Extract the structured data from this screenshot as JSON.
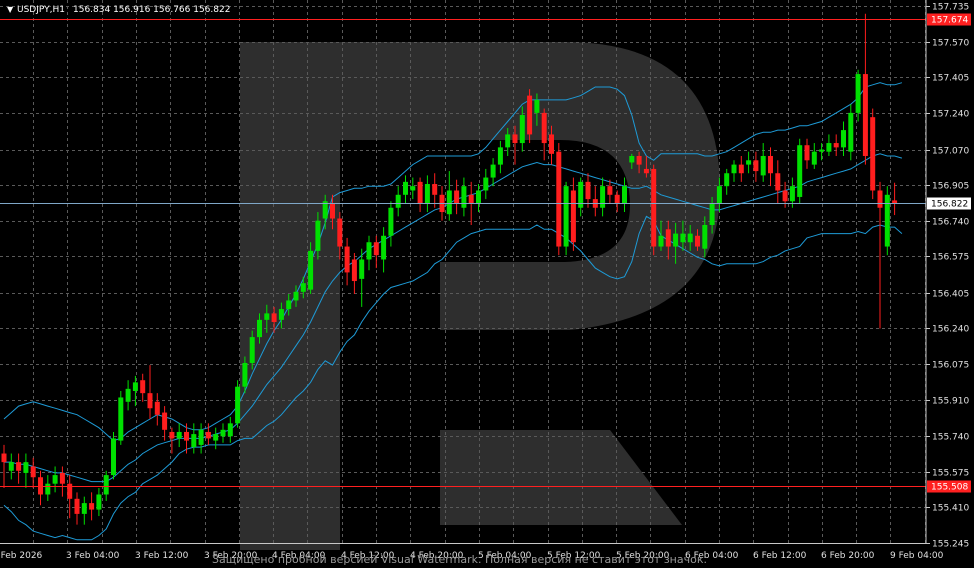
{
  "header": {
    "symbol": "USDJPY,H1",
    "ohlc": "156.834 156.916 156.766 156.822"
  },
  "watermark_text": "Защищено пробной версией Visual Watermark. Полная версия не ставит этот значок.",
  "colors": {
    "background": "#000000",
    "grid": "#5a5a5a",
    "bull": "#00e000",
    "bear": "#ff1e1e",
    "bands": "#1e9bd7",
    "level_line": "#ff2020",
    "price_line": "#7fa7c8",
    "watermark": "#3c3c3c"
  },
  "chart_data": {
    "type": "candlestick",
    "symbol": "USDJPY",
    "timeframe": "H1",
    "y_range": [
      155.245,
      157.7635
    ],
    "y_ticks": [
      "157.735",
      "157.570",
      "157.405",
      "157.240",
      "157.070",
      "156.905",
      "156.740",
      "156.575",
      "156.405",
      "156.240",
      "156.075",
      "155.910",
      "155.740",
      "155.575",
      "155.410",
      "155.245"
    ],
    "x_ticks": [
      "2 Feb 2026",
      "3 Feb 04:00",
      "3 Feb 12:00",
      "3 Feb 20:00",
      "4 Feb 04:00",
      "4 Feb 12:00",
      "4 Feb 20:00",
      "5 Feb 04:00",
      "5 Feb 12:00",
      "5 Feb 20:00",
      "6 Feb 04:00",
      "6 Feb 12:00",
      "6 Feb 20:00",
      "9 Feb 04:00"
    ],
    "levels": [
      {
        "price": 157.674,
        "label": "157.674",
        "color": "#ff2020"
      },
      {
        "price": 155.508,
        "label": "155.508",
        "color": "#ff2020"
      }
    ],
    "current_price": {
      "price": 156.822,
      "label": "156.822"
    },
    "indicator": "Bollinger Bands",
    "candles": [
      [
        155.66,
        155.62,
        155.5,
        155.7
      ],
      [
        155.58,
        155.62,
        155.54,
        155.66
      ],
      [
        155.62,
        155.58,
        155.52,
        155.66
      ],
      [
        155.57,
        155.62,
        155.5,
        155.66
      ],
      [
        155.6,
        155.55,
        155.5,
        155.64
      ],
      [
        155.55,
        155.47,
        155.42,
        155.58
      ],
      [
        155.47,
        155.52,
        155.44,
        155.56
      ],
      [
        155.52,
        155.56,
        155.48,
        155.6
      ],
      [
        155.57,
        155.52,
        155.46,
        155.6
      ],
      [
        155.52,
        155.45,
        155.36,
        155.56
      ],
      [
        155.45,
        155.38,
        155.33,
        155.48
      ],
      [
        155.38,
        155.43,
        155.33,
        155.46
      ],
      [
        155.43,
        155.4,
        155.35,
        155.48
      ],
      [
        155.4,
        155.47,
        155.37,
        155.5
      ],
      [
        155.47,
        155.56,
        155.44,
        155.58
      ],
      [
        155.56,
        155.73,
        155.54,
        155.76
      ],
      [
        155.72,
        155.92,
        155.7,
        155.95
      ],
      [
        155.9,
        155.96,
        155.86,
        156.0
      ],
      [
        155.95,
        155.99,
        155.88,
        156.02
      ],
      [
        156.0,
        155.94,
        155.9,
        156.03
      ],
      [
        155.94,
        155.87,
        155.82,
        156.07
      ],
      [
        155.9,
        155.84,
        155.79,
        155.94
      ],
      [
        155.85,
        155.77,
        155.72,
        155.88
      ],
      [
        155.76,
        155.73,
        155.66,
        155.78
      ],
      [
        155.73,
        155.76,
        155.69,
        155.8
      ],
      [
        155.76,
        155.72,
        155.66,
        155.8
      ],
      [
        155.69,
        155.75,
        155.66,
        155.8
      ],
      [
        155.7,
        155.77,
        155.66,
        155.8
      ],
      [
        155.76,
        155.73,
        155.7,
        155.8
      ],
      [
        155.72,
        155.75,
        155.68,
        155.78
      ],
      [
        155.74,
        155.77,
        155.71,
        155.8
      ],
      [
        155.74,
        155.8,
        155.71,
        155.83
      ],
      [
        155.8,
        155.97,
        155.78,
        156.0
      ],
      [
        155.97,
        156.08,
        155.94,
        156.11
      ],
      [
        156.08,
        156.2,
        156.05,
        156.23
      ],
      [
        156.2,
        156.28,
        156.17,
        156.31
      ],
      [
        156.28,
        156.31,
        156.22,
        156.35
      ],
      [
        156.31,
        156.27,
        156.22,
        156.34
      ],
      [
        156.28,
        156.33,
        156.24,
        156.36
      ],
      [
        156.33,
        156.37,
        156.3,
        156.4
      ],
      [
        156.37,
        156.41,
        156.34,
        156.44
      ],
      [
        156.41,
        156.45,
        156.38,
        156.48
      ],
      [
        156.42,
        156.6,
        156.4,
        156.64
      ],
      [
        156.6,
        156.74,
        156.56,
        156.78
      ],
      [
        156.75,
        156.83,
        156.7,
        156.86
      ],
      [
        156.82,
        156.75,
        156.7,
        156.86
      ],
      [
        156.75,
        156.62,
        156.56,
        156.78
      ],
      [
        156.62,
        156.5,
        156.44,
        156.66
      ],
      [
        156.56,
        156.46,
        156.4,
        156.59
      ],
      [
        156.47,
        156.56,
        156.34,
        156.61
      ],
      [
        156.56,
        156.64,
        156.51,
        156.67
      ],
      [
        156.64,
        156.58,
        156.52,
        156.67
      ],
      [
        156.56,
        156.67,
        156.5,
        156.71
      ],
      [
        156.67,
        156.8,
        156.62,
        156.83
      ],
      [
        156.8,
        156.86,
        156.76,
        156.9
      ],
      [
        156.86,
        156.92,
        156.82,
        156.95
      ],
      [
        156.88,
        156.9,
        156.84,
        156.94
      ],
      [
        156.92,
        156.82,
        156.78,
        156.94
      ],
      [
        156.82,
        156.91,
        156.78,
        156.95
      ],
      [
        156.91,
        156.86,
        156.8,
        156.96
      ],
      [
        156.86,
        156.78,
        156.74,
        156.9
      ],
      [
        156.77,
        156.88,
        156.74,
        156.97
      ],
      [
        156.88,
        156.82,
        156.77,
        156.93
      ],
      [
        156.8,
        156.9,
        156.76,
        156.94
      ],
      [
        156.86,
        156.82,
        156.72,
        156.92
      ],
      [
        156.82,
        156.88,
        156.78,
        156.91
      ],
      [
        156.88,
        156.94,
        156.84,
        156.98
      ],
      [
        156.94,
        157.0,
        156.9,
        157.03
      ],
      [
        157.0,
        157.08,
        156.96,
        157.11
      ],
      [
        157.08,
        157.14,
        157.04,
        157.17
      ],
      [
        157.14,
        157.1,
        157.0,
        157.18
      ],
      [
        157.1,
        157.23,
        157.06,
        157.27
      ],
      [
        157.32,
        157.14,
        157.1,
        157.35
      ],
      [
        157.24,
        157.3,
        157.18,
        157.33
      ],
      [
        157.24,
        157.1,
        157.02,
        157.26
      ],
      [
        157.14,
        157.05,
        157.0,
        157.18
      ],
      [
        157.06,
        156.62,
        156.58,
        157.1
      ],
      [
        156.62,
        156.9,
        156.58,
        156.92
      ],
      [
        156.88,
        156.64,
        156.6,
        156.94
      ],
      [
        156.8,
        156.92,
        156.76,
        156.94
      ],
      [
        156.92,
        156.84,
        156.8,
        156.96
      ],
      [
        156.84,
        156.8,
        156.76,
        156.9
      ],
      [
        156.8,
        156.9,
        156.76,
        156.94
      ],
      [
        156.9,
        156.86,
        156.82,
        156.93
      ],
      [
        156.86,
        156.82,
        156.78,
        156.88
      ],
      [
        156.82,
        156.9,
        156.78,
        156.94
      ],
      [
        157.01,
        157.04,
        156.98,
        157.05
      ],
      [
        157.04,
        157.0,
        156.96,
        157.06
      ],
      [
        156.98,
        156.96,
        156.94,
        157.04
      ],
      [
        156.98,
        156.62,
        156.58,
        157.0
      ],
      [
        156.62,
        156.67,
        156.6,
        156.74
      ],
      [
        156.7,
        156.62,
        156.56,
        156.74
      ],
      [
        156.62,
        156.68,
        156.54,
        156.73
      ],
      [
        156.64,
        156.68,
        156.6,
        156.74
      ],
      [
        156.64,
        156.68,
        156.6,
        156.72
      ],
      [
        156.67,
        156.62,
        156.6,
        156.7
      ],
      [
        156.61,
        156.72,
        156.57,
        156.76
      ],
      [
        156.72,
        156.82,
        156.68,
        156.85
      ],
      [
        156.82,
        156.9,
        156.78,
        156.94
      ],
      [
        156.9,
        156.96,
        156.86,
        156.98
      ],
      [
        156.96,
        157.0,
        156.92,
        157.02
      ],
      [
        157.0,
        156.96,
        156.92,
        157.04
      ],
      [
        157.0,
        157.02,
        156.96,
        157.06
      ],
      [
        157.02,
        156.97,
        156.92,
        157.06
      ],
      [
        156.95,
        157.04,
        156.92,
        157.1
      ],
      [
        157.04,
        156.96,
        156.9,
        157.08
      ],
      [
        156.96,
        156.88,
        156.82,
        157.02
      ],
      [
        156.88,
        156.83,
        156.8,
        156.92
      ],
      [
        156.83,
        156.9,
        156.8,
        156.94
      ],
      [
        156.85,
        157.09,
        156.82,
        157.12
      ],
      [
        157.09,
        157.02,
        156.98,
        157.12
      ],
      [
        157.0,
        157.06,
        156.98,
        157.1
      ],
      [
        157.06,
        157.07,
        157.02,
        157.1
      ],
      [
        157.06,
        157.1,
        157.04,
        157.14
      ],
      [
        157.1,
        157.08,
        157.04,
        157.14
      ],
      [
        157.08,
        157.16,
        157.04,
        157.2
      ],
      [
        157.06,
        157.24,
        157.02,
        157.28
      ],
      [
        157.24,
        157.42,
        157.2,
        157.44
      ],
      [
        157.42,
        157.04,
        157.0,
        157.7
      ],
      [
        157.22,
        156.88,
        156.84,
        157.26
      ],
      [
        156.88,
        156.8,
        156.24,
        156.92
      ],
      [
        156.62,
        156.86,
        156.58,
        156.9
      ],
      [
        156.834,
        156.822,
        156.766,
        156.916
      ]
    ],
    "bb_upper": [
      155.82,
      155.85,
      155.88,
      155.89,
      155.9,
      155.89,
      155.88,
      155.87,
      155.86,
      155.85,
      155.84,
      155.82,
      155.8,
      155.78,
      155.75,
      155.72,
      155.73,
      155.76,
      155.78,
      155.8,
      155.82,
      155.84,
      155.83,
      155.82,
      155.8,
      155.78,
      155.77,
      155.77,
      155.78,
      155.8,
      155.82,
      155.84,
      155.88,
      155.95,
      156.03,
      156.1,
      156.17,
      156.23,
      156.28,
      156.34,
      156.4,
      156.47,
      156.55,
      156.63,
      156.73,
      156.85,
      156.87,
      156.88,
      156.89,
      156.89,
      156.9,
      156.9,
      156.9,
      156.91,
      156.94,
      156.97,
      157.0,
      157.02,
      157.04,
      157.04,
      157.04,
      157.04,
      157.04,
      157.04,
      157.04,
      157.05,
      157.08,
      157.12,
      157.16,
      157.2,
      157.24,
      157.28,
      157.3,
      157.3,
      157.3,
      157.3,
      157.3,
      157.3,
      157.31,
      157.32,
      157.34,
      157.36,
      157.36,
      157.36,
      157.35,
      157.32,
      157.23,
      157.1,
      157.04,
      157.02,
      157.05,
      157.05,
      157.05,
      157.05,
      157.05,
      157.05,
      157.04,
      157.04,
      157.05,
      157.06,
      157.08,
      157.1,
      157.12,
      157.14,
      157.15,
      157.15,
      157.16,
      157.16,
      157.17,
      157.18,
      157.18,
      157.19,
      157.2,
      157.22,
      157.24,
      157.26,
      157.28,
      157.31,
      157.36,
      157.37,
      157.38,
      157.37,
      157.37,
      157.38
    ],
    "bb_middle": [
      155.62,
      155.62,
      155.61,
      155.61,
      155.6,
      155.59,
      155.58,
      155.57,
      155.57,
      155.56,
      155.55,
      155.54,
      155.53,
      155.53,
      155.53,
      155.55,
      155.58,
      155.61,
      155.63,
      155.66,
      155.68,
      155.7,
      155.71,
      155.72,
      155.73,
      155.73,
      155.73,
      155.73,
      155.74,
      155.75,
      155.76,
      155.77,
      155.8,
      155.84,
      155.88,
      155.93,
      155.98,
      156.02,
      156.06,
      156.11,
      156.16,
      156.21,
      156.27,
      156.34,
      156.41,
      156.46,
      156.5,
      156.53,
      156.55,
      156.58,
      156.61,
      156.63,
      156.65,
      156.67,
      156.69,
      156.71,
      156.73,
      156.75,
      156.77,
      156.79,
      156.8,
      156.82,
      156.84,
      156.85,
      156.86,
      156.87,
      156.89,
      156.91,
      156.93,
      156.95,
      156.97,
      156.99,
      157.0,
      157.01,
      157.0,
      157.0,
      156.99,
      156.98,
      156.97,
      156.96,
      156.95,
      156.94,
      156.93,
      156.92,
      156.91,
      156.9,
      156.89,
      156.89,
      156.9,
      156.88,
      156.86,
      156.85,
      156.84,
      156.83,
      156.82,
      156.81,
      156.8,
      156.79,
      156.79,
      156.8,
      156.81,
      156.82,
      156.83,
      156.84,
      156.85,
      156.86,
      156.87,
      156.88,
      156.89,
      156.9,
      156.92,
      156.93,
      156.94,
      156.95,
      156.96,
      156.97,
      156.98,
      157.0,
      157.02,
      157.04,
      157.05,
      157.04,
      157.04,
      157.03
    ],
    "bb_lower": [
      155.42,
      155.39,
      155.35,
      155.33,
      155.3,
      155.29,
      155.28,
      155.27,
      155.28,
      155.27,
      155.26,
      155.26,
      155.26,
      155.28,
      155.31,
      155.38,
      155.43,
      155.46,
      155.48,
      155.52,
      155.54,
      155.56,
      155.59,
      155.62,
      155.66,
      155.68,
      155.69,
      155.69,
      155.7,
      155.7,
      155.7,
      155.7,
      155.72,
      155.73,
      155.73,
      155.76,
      155.79,
      155.81,
      155.84,
      155.88,
      155.92,
      155.95,
      155.99,
      156.05,
      156.09,
      156.07,
      156.13,
      156.18,
      156.21,
      156.27,
      156.32,
      156.36,
      156.4,
      156.43,
      156.44,
      156.45,
      156.46,
      156.48,
      156.5,
      156.54,
      156.56,
      156.6,
      156.64,
      156.66,
      156.68,
      156.69,
      156.7,
      156.7,
      156.7,
      156.7,
      156.7,
      156.7,
      156.7,
      156.72,
      156.7,
      156.7,
      156.68,
      156.66,
      156.63,
      156.6,
      156.56,
      156.52,
      156.5,
      156.48,
      156.47,
      156.48,
      156.55,
      156.68,
      156.76,
      156.74,
      156.67,
      156.65,
      156.63,
      156.61,
      156.59,
      156.57,
      156.56,
      156.54,
      156.53,
      156.54,
      156.54,
      156.54,
      156.54,
      156.54,
      156.55,
      156.57,
      156.58,
      156.6,
      156.61,
      156.62,
      156.66,
      156.67,
      156.68,
      156.68,
      156.68,
      156.68,
      156.68,
      156.69,
      156.68,
      156.71,
      156.72,
      156.71,
      156.71,
      156.68
    ]
  }
}
